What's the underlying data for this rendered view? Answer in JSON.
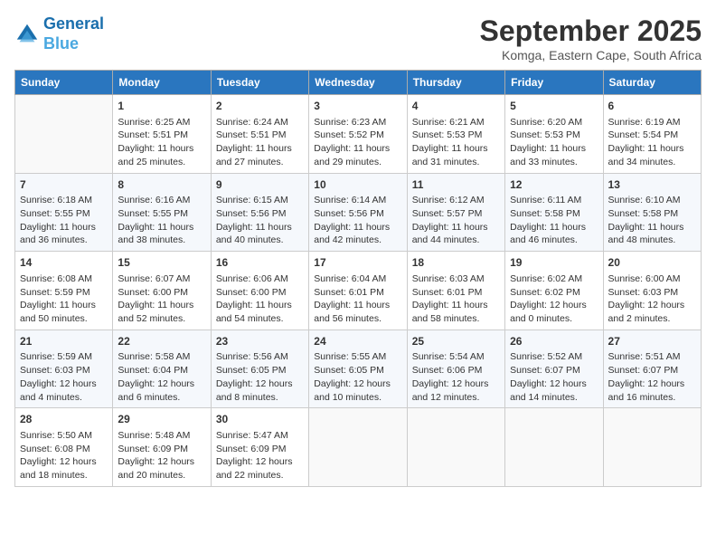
{
  "logo": {
    "line1": "General",
    "line2": "Blue"
  },
  "title": "September 2025",
  "location": "Komga, Eastern Cape, South Africa",
  "days_of_week": [
    "Sunday",
    "Monday",
    "Tuesday",
    "Wednesday",
    "Thursday",
    "Friday",
    "Saturday"
  ],
  "weeks": [
    [
      {
        "day": "",
        "info": ""
      },
      {
        "day": "1",
        "info": "Sunrise: 6:25 AM\nSunset: 5:51 PM\nDaylight: 11 hours\nand 25 minutes."
      },
      {
        "day": "2",
        "info": "Sunrise: 6:24 AM\nSunset: 5:51 PM\nDaylight: 11 hours\nand 27 minutes."
      },
      {
        "day": "3",
        "info": "Sunrise: 6:23 AM\nSunset: 5:52 PM\nDaylight: 11 hours\nand 29 minutes."
      },
      {
        "day": "4",
        "info": "Sunrise: 6:21 AM\nSunset: 5:53 PM\nDaylight: 11 hours\nand 31 minutes."
      },
      {
        "day": "5",
        "info": "Sunrise: 6:20 AM\nSunset: 5:53 PM\nDaylight: 11 hours\nand 33 minutes."
      },
      {
        "day": "6",
        "info": "Sunrise: 6:19 AM\nSunset: 5:54 PM\nDaylight: 11 hours\nand 34 minutes."
      }
    ],
    [
      {
        "day": "7",
        "info": "Sunrise: 6:18 AM\nSunset: 5:55 PM\nDaylight: 11 hours\nand 36 minutes."
      },
      {
        "day": "8",
        "info": "Sunrise: 6:16 AM\nSunset: 5:55 PM\nDaylight: 11 hours\nand 38 minutes."
      },
      {
        "day": "9",
        "info": "Sunrise: 6:15 AM\nSunset: 5:56 PM\nDaylight: 11 hours\nand 40 minutes."
      },
      {
        "day": "10",
        "info": "Sunrise: 6:14 AM\nSunset: 5:56 PM\nDaylight: 11 hours\nand 42 minutes."
      },
      {
        "day": "11",
        "info": "Sunrise: 6:12 AM\nSunset: 5:57 PM\nDaylight: 11 hours\nand 44 minutes."
      },
      {
        "day": "12",
        "info": "Sunrise: 6:11 AM\nSunset: 5:58 PM\nDaylight: 11 hours\nand 46 minutes."
      },
      {
        "day": "13",
        "info": "Sunrise: 6:10 AM\nSunset: 5:58 PM\nDaylight: 11 hours\nand 48 minutes."
      }
    ],
    [
      {
        "day": "14",
        "info": "Sunrise: 6:08 AM\nSunset: 5:59 PM\nDaylight: 11 hours\nand 50 minutes."
      },
      {
        "day": "15",
        "info": "Sunrise: 6:07 AM\nSunset: 6:00 PM\nDaylight: 11 hours\nand 52 minutes."
      },
      {
        "day": "16",
        "info": "Sunrise: 6:06 AM\nSunset: 6:00 PM\nDaylight: 11 hours\nand 54 minutes."
      },
      {
        "day": "17",
        "info": "Sunrise: 6:04 AM\nSunset: 6:01 PM\nDaylight: 11 hours\nand 56 minutes."
      },
      {
        "day": "18",
        "info": "Sunrise: 6:03 AM\nSunset: 6:01 PM\nDaylight: 11 hours\nand 58 minutes."
      },
      {
        "day": "19",
        "info": "Sunrise: 6:02 AM\nSunset: 6:02 PM\nDaylight: 12 hours\nand 0 minutes."
      },
      {
        "day": "20",
        "info": "Sunrise: 6:00 AM\nSunset: 6:03 PM\nDaylight: 12 hours\nand 2 minutes."
      }
    ],
    [
      {
        "day": "21",
        "info": "Sunrise: 5:59 AM\nSunset: 6:03 PM\nDaylight: 12 hours\nand 4 minutes."
      },
      {
        "day": "22",
        "info": "Sunrise: 5:58 AM\nSunset: 6:04 PM\nDaylight: 12 hours\nand 6 minutes."
      },
      {
        "day": "23",
        "info": "Sunrise: 5:56 AM\nSunset: 6:05 PM\nDaylight: 12 hours\nand 8 minutes."
      },
      {
        "day": "24",
        "info": "Sunrise: 5:55 AM\nSunset: 6:05 PM\nDaylight: 12 hours\nand 10 minutes."
      },
      {
        "day": "25",
        "info": "Sunrise: 5:54 AM\nSunset: 6:06 PM\nDaylight: 12 hours\nand 12 minutes."
      },
      {
        "day": "26",
        "info": "Sunrise: 5:52 AM\nSunset: 6:07 PM\nDaylight: 12 hours\nand 14 minutes."
      },
      {
        "day": "27",
        "info": "Sunrise: 5:51 AM\nSunset: 6:07 PM\nDaylight: 12 hours\nand 16 minutes."
      }
    ],
    [
      {
        "day": "28",
        "info": "Sunrise: 5:50 AM\nSunset: 6:08 PM\nDaylight: 12 hours\nand 18 minutes."
      },
      {
        "day": "29",
        "info": "Sunrise: 5:48 AM\nSunset: 6:09 PM\nDaylight: 12 hours\nand 20 minutes."
      },
      {
        "day": "30",
        "info": "Sunrise: 5:47 AM\nSunset: 6:09 PM\nDaylight: 12 hours\nand 22 minutes."
      },
      {
        "day": "",
        "info": ""
      },
      {
        "day": "",
        "info": ""
      },
      {
        "day": "",
        "info": ""
      },
      {
        "day": "",
        "info": ""
      }
    ]
  ]
}
